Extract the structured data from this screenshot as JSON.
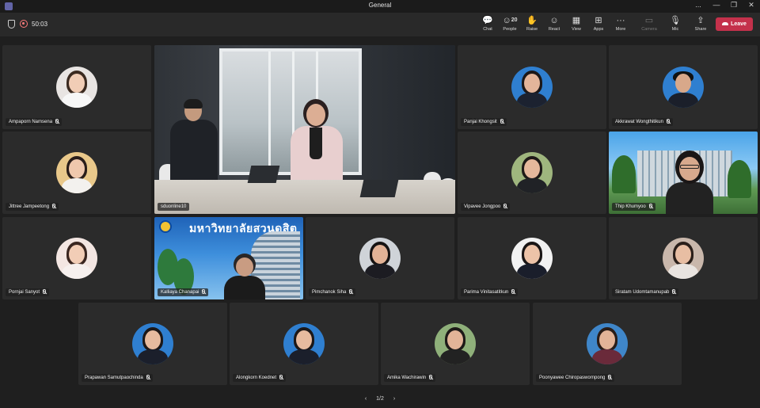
{
  "window": {
    "title": "General",
    "controls": [
      "...",
      "—",
      "❐",
      "✕"
    ]
  },
  "toolbar": {
    "timer": "50:03",
    "buttons": [
      {
        "label": "Chat",
        "icon": "chat-icon"
      },
      {
        "label": "People",
        "icon": "people-icon",
        "count": "20"
      },
      {
        "label": "Raise",
        "icon": "raise-hand-icon"
      },
      {
        "label": "React",
        "icon": "react-icon"
      },
      {
        "label": "View",
        "icon": "view-icon"
      },
      {
        "label": "Apps",
        "icon": "apps-icon"
      },
      {
        "label": "More",
        "icon": "more-icon"
      },
      {
        "label": "Camera",
        "icon": "camera-icon"
      },
      {
        "label": "Mic",
        "icon": "mic-icon"
      },
      {
        "label": "Share",
        "icon": "share-icon"
      }
    ],
    "leave_label": "Leave",
    "leave_color": "#c4314b"
  },
  "participants": [
    {
      "name": "Ampaporn Namsena",
      "muted": true
    },
    {
      "name": "sduonline10",
      "muted": false
    },
    {
      "name": "Panjai Khongsit",
      "muted": true
    },
    {
      "name": "Akkrawat Wongthitikun",
      "muted": true
    },
    {
      "name": "Jittree Jampeetong",
      "muted": true
    },
    {
      "name": "Vipavee Jongpoo",
      "muted": true
    },
    {
      "name": "Thip Khumyoo",
      "muted": true
    },
    {
      "name": "Pornjai Sanyot",
      "muted": true
    },
    {
      "name": "Kalliaya Chanapai",
      "muted": true
    },
    {
      "name": "Pimchanok Siha",
      "muted": true
    },
    {
      "name": "Parima Vinitasatitkun",
      "muted": true
    },
    {
      "name": "Siratam Udomtamanupab",
      "muted": true
    },
    {
      "name": "Prapawan Samutpaochinda",
      "muted": true
    },
    {
      "name": "Alongkorn Koednet",
      "muted": true
    },
    {
      "name": "Amika Wachirawin",
      "muted": true
    },
    {
      "name": "Poonyawee Chiropaswornpong",
      "muted": true
    }
  ],
  "banner_text": "มหาวิทยาลัยสวนดุสิต",
  "pager": {
    "page": "1/2",
    "prev": "‹",
    "next": "›"
  }
}
